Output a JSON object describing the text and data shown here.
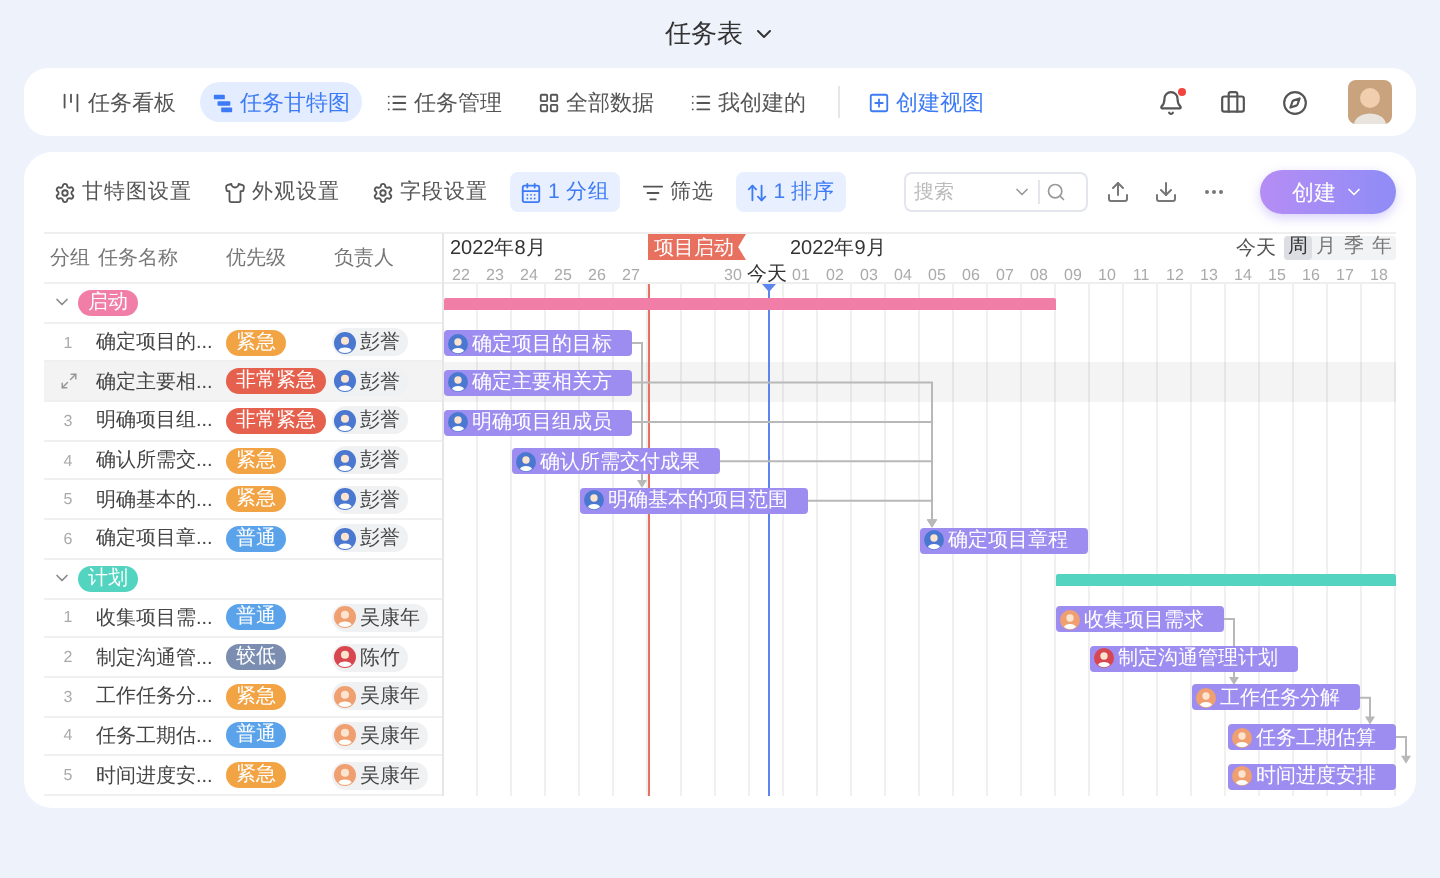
{
  "title": "任务表",
  "nav": {
    "tabs": [
      {
        "label": "任务看板",
        "kind": "board",
        "selected": false
      },
      {
        "label": "任务甘特图",
        "kind": "gantt",
        "selected": true
      },
      {
        "label": "任务管理",
        "kind": "list",
        "selected": false
      },
      {
        "label": "全部数据",
        "kind": "grid",
        "selected": false
      },
      {
        "label": "我创建的",
        "kind": "list",
        "selected": false
      }
    ],
    "create_view": "创建视图",
    "unread": true
  },
  "toolbar": {
    "items": [
      {
        "label": "甘特图设置",
        "kind": "gear",
        "active": false
      },
      {
        "label": "外观设置",
        "kind": "shirt",
        "active": false
      },
      {
        "label": "字段设置",
        "kind": "gear",
        "active": false
      },
      {
        "label": "1 分组",
        "kind": "calendar",
        "active": true
      },
      {
        "label": "筛选",
        "kind": "filter",
        "active": false
      },
      {
        "label": "1 排序",
        "kind": "sort",
        "active": true
      }
    ],
    "search": {
      "placeholder": "搜索"
    },
    "create": "创建"
  },
  "table": {
    "columns": [
      "分组",
      "任务名称",
      "优先级",
      "负责人"
    ]
  },
  "gantt": {
    "months": [
      "2022年8月",
      "2022年9月"
    ],
    "today_button": "今天",
    "scales": [
      {
        "label": "周",
        "selected": true
      },
      {
        "label": "月",
        "selected": false
      },
      {
        "label": "季",
        "selected": false
      },
      {
        "label": "年",
        "selected": false
      }
    ],
    "days": [
      {
        "kind": "day",
        "label": "22"
      },
      {
        "kind": "day",
        "label": "23"
      },
      {
        "kind": "day",
        "label": "24"
      },
      {
        "kind": "day",
        "label": "25"
      },
      {
        "kind": "day",
        "label": "26"
      },
      {
        "kind": "day",
        "label": "27"
      },
      {
        "kind": "milestone",
        "label": "项目启动"
      },
      {
        "kind": "day",
        "label": "30"
      },
      {
        "kind": "today",
        "label": "今天"
      },
      {
        "kind": "day",
        "label": "01"
      },
      {
        "kind": "day",
        "label": "02"
      },
      {
        "kind": "day",
        "label": "03"
      },
      {
        "kind": "day",
        "label": "04"
      },
      {
        "kind": "day",
        "label": "05"
      },
      {
        "kind": "day",
        "label": "06"
      },
      {
        "kind": "day",
        "label": "07"
      },
      {
        "kind": "day",
        "label": "08"
      },
      {
        "kind": "day",
        "label": "09"
      },
      {
        "kind": "day",
        "label": "10"
      },
      {
        "kind": "day",
        "label": "11"
      },
      {
        "kind": "day",
        "label": "12"
      },
      {
        "kind": "day",
        "label": "13"
      },
      {
        "kind": "day",
        "label": "14"
      },
      {
        "kind": "day",
        "label": "15"
      },
      {
        "kind": "day",
        "label": "16"
      },
      {
        "kind": "day",
        "label": "17"
      },
      {
        "kind": "day",
        "label": "18"
      }
    ]
  },
  "groups": [
    {
      "name": "启动",
      "color": "#f07ea6",
      "expanded": true,
      "tasks": [
        {
          "no": "1",
          "name": "确定项目的...",
          "priority": {
            "label": "紧急",
            "color": "#f2a445"
          },
          "assignee": {
            "name": "彭誉",
            "color": "#4a78d0"
          },
          "bar": "确定项目的目标",
          "hovered": false
        },
        {
          "name": "确定主要相...",
          "priority": {
            "label": "非常紧急",
            "color": "#e5604d"
          },
          "assignee": {
            "name": "彭誉",
            "color": "#4a78d0"
          },
          "bar": "确定主要相关方",
          "hovered": true
        },
        {
          "no": "3",
          "name": "明确项目组...",
          "priority": {
            "label": "非常紧急",
            "color": "#e5604d"
          },
          "assignee": {
            "name": "彭誉",
            "color": "#4a78d0"
          },
          "bar": "明确项目组成员",
          "hovered": false
        },
        {
          "no": "4",
          "name": "确认所需交...",
          "priority": {
            "label": "紧急",
            "color": "#f2a445"
          },
          "assignee": {
            "name": "彭誉",
            "color": "#4a78d0"
          },
          "bar": "确认所需交付成果",
          "hovered": false
        },
        {
          "no": "5",
          "name": "明确基本的...",
          "priority": {
            "label": "紧急",
            "color": "#f2a445"
          },
          "assignee": {
            "name": "彭誉",
            "color": "#4a78d0"
          },
          "bar": "明确基本的项目范围",
          "hovered": false
        },
        {
          "no": "6",
          "name": "确定项目章...",
          "priority": {
            "label": "普通",
            "color": "#5aa3ea"
          },
          "assignee": {
            "name": "彭誉",
            "color": "#4a78d0"
          },
          "bar": "确定项目章程",
          "hovered": false
        }
      ]
    },
    {
      "name": "计划",
      "color": "#52d4c0",
      "expanded": true,
      "tasks": [
        {
          "no": "1",
          "name": "收集项目需...",
          "priority": {
            "label": "普通",
            "color": "#5aa3ea"
          },
          "assignee": {
            "name": "吴康年",
            "color": "#f0a070"
          },
          "bar": "收集项目需求",
          "hovered": false
        },
        {
          "no": "2",
          "name": "制定沟通管...",
          "priority": {
            "label": "较低",
            "color": "#7b8db0"
          },
          "assignee": {
            "name": "陈竹",
            "color": "#d8474f"
          },
          "bar": "制定沟通管理计划",
          "hovered": false
        },
        {
          "no": "3",
          "name": "工作任务分...",
          "priority": {
            "label": "紧急",
            "color": "#f2a445"
          },
          "assignee": {
            "name": "吴康年",
            "color": "#f0a070"
          },
          "bar": "工作任务分解",
          "hovered": false
        },
        {
          "no": "4",
          "name": "任务工期估...",
          "priority": {
            "label": "普通",
            "color": "#5aa3ea"
          },
          "assignee": {
            "name": "吴康年",
            "color": "#f0a070"
          },
          "bar": "任务工期估算",
          "hovered": false
        },
        {
          "no": "5",
          "name": "时间进度安...",
          "priority": {
            "label": "紧急",
            "color": "#f2a445"
          },
          "assignee": {
            "name": "吴康年",
            "color": "#f0a070"
          },
          "bar": "时间进度安排",
          "hovered": false
        }
      ]
    }
  ]
}
